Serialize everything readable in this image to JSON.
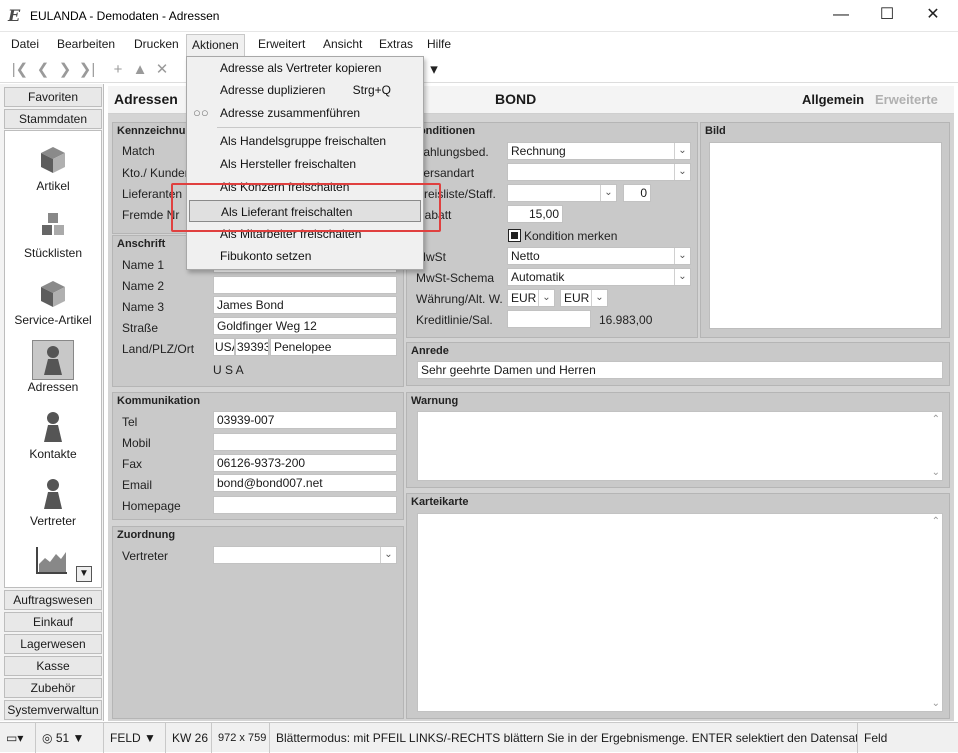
{
  "window": {
    "title": "EULANDA - Demodaten - Adressen",
    "app_icon": "eulanda-e-icon",
    "controls": [
      "minimize-icon",
      "maximize-icon",
      "close-icon"
    ]
  },
  "menubar": {
    "items": [
      "Datei",
      "Bearbeiten",
      "Drucken",
      "Aktionen",
      "Erweitert",
      "Ansicht",
      "Extras",
      "Hilfe"
    ],
    "active": "Aktionen"
  },
  "actions_menu": {
    "items": [
      {
        "label": "Adresse als Vertreter kopieren",
        "shortcut": ""
      },
      {
        "label": "Adresse duplizieren",
        "shortcut": "Strg+Q"
      },
      {
        "label": "Adresse zusammenführen",
        "shortcut": "",
        "icon": "merge-rings-icon"
      },
      {
        "label": "Als Handelsgruppe freischalten",
        "shortcut": ""
      },
      {
        "label": "Als Hersteller freischalten",
        "shortcut": ""
      },
      {
        "label": "Als Konzern freischalten",
        "shortcut": ""
      },
      {
        "label": "Als Lieferant freischalten",
        "shortcut": "",
        "highlighted": true
      },
      {
        "label": "Als Mitarbeiter freischalten",
        "shortcut": ""
      },
      {
        "label": "Fibukonto setzen",
        "shortcut": ""
      }
    ],
    "highlight_color": "#e0403f"
  },
  "sidebar": {
    "top_buttons": [
      "Favoriten",
      "Stammdaten"
    ],
    "modules": [
      {
        "label": "Artikel",
        "icon": "cube-icon"
      },
      {
        "label": "Stücklisten",
        "icon": "cubes-icon"
      },
      {
        "label": "Service-Artikel",
        "icon": "cube-icon"
      },
      {
        "label": "Adressen",
        "icon": "person-icon",
        "active": true
      },
      {
        "label": "Kontakte",
        "icon": "person-icon"
      },
      {
        "label": "Vertreter",
        "icon": "person-icon"
      },
      {
        "label": "",
        "icon": "chart-icon"
      }
    ],
    "bottom_buttons": [
      "Auftragswesen",
      "Einkauf",
      "Lagerwesen",
      "Kasse",
      "Zubehör",
      "Systemverwaltun"
    ]
  },
  "header": {
    "section": "Adressen",
    "record": "BOND",
    "tab_active": "Allgemein",
    "tab_inactive": "Erweiterte"
  },
  "kennzeichnung": {
    "title": "Kennzeichnung",
    "labels": [
      "Match",
      "Kto./ Kunden",
      "Lieferanten",
      "Fremde Nr"
    ]
  },
  "anschrift": {
    "title": "Anschrift",
    "labels": [
      "Name 1",
      "Name 2",
      "Name 3",
      "Straße",
      "Land/PLZ/Ort"
    ],
    "name1": "",
    "name2": "",
    "name3": "James Bond",
    "strasse": "Goldfinger Weg 12",
    "land": "USA",
    "plz": "39393",
    "ort": "Penelopee",
    "country_line": "U S A"
  },
  "kommunikation": {
    "title": "Kommunikation",
    "labels": [
      "Tel",
      "Mobil",
      "Fax",
      "Email",
      "Homepage"
    ],
    "tel": "03939-007",
    "mobil": "",
    "fax": "06126-9373-200",
    "email": "bond@bond007.net",
    "homepage": ""
  },
  "zuordnung": {
    "title": "Zuordnung",
    "labels": [
      "Vertreter"
    ],
    "vertreter": ""
  },
  "konditionen": {
    "title": "Konditionen",
    "labels": [
      "Zahlungsbed.",
      "Versandart",
      "Preisliste/Staff.",
      "Rabatt",
      "MwSt",
      "MwSt-Schema",
      "Währung/Alt. W.",
      "Kreditlinie/Sal."
    ],
    "zahlungsbed": "Rechnung",
    "versandart": "",
    "preisliste": "",
    "staffel": "0",
    "rabatt": "15,00",
    "kondition_merken": "Kondition merken",
    "mwst": "Netto",
    "mwst_schema": "Automatik",
    "waehrung": "EUR",
    "alt_waehrung": "EUR",
    "kreditlinie": "",
    "saldo": "16.983,00"
  },
  "bild": {
    "title": "Bild"
  },
  "anrede": {
    "title": "Anrede",
    "value": "Sehr geehrte Damen und Herren"
  },
  "warnung": {
    "title": "Warnung",
    "value": ""
  },
  "karteikarte": {
    "title": "Karteikarte",
    "value": ""
  },
  "statusbar": {
    "count": "51",
    "mode": "FELD",
    "week": "KW 26",
    "resolution": "972 x 759",
    "message": "Blättermodus: mit PFEIL LINKS/-RECHTS blättern Sie in der Ergebnismenge. ENTER selektiert den Datensatz",
    "field": "Feld"
  }
}
